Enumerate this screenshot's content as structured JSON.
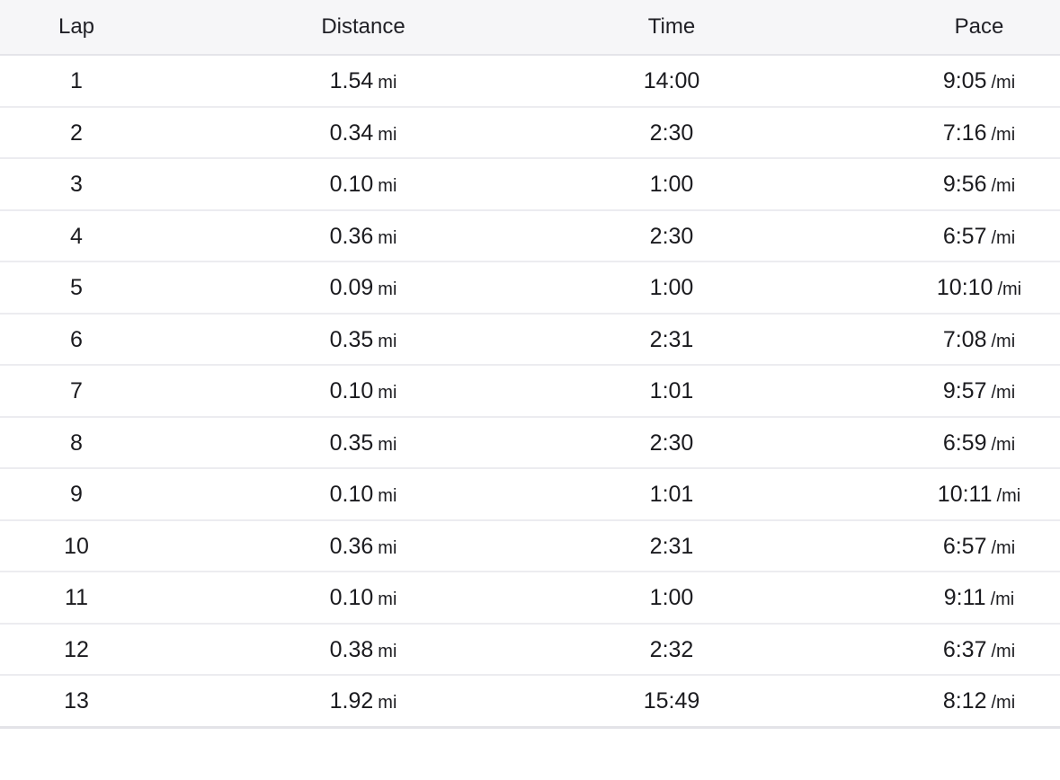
{
  "table": {
    "headers": {
      "lap": "Lap",
      "distance": "Distance",
      "time": "Time",
      "pace": "Pace"
    },
    "distance_unit": "mi",
    "pace_unit": "/mi",
    "rows": [
      {
        "lap": "1",
        "distance": "1.54",
        "time": "14:00",
        "pace": "9:05"
      },
      {
        "lap": "2",
        "distance": "0.34",
        "time": "2:30",
        "pace": "7:16"
      },
      {
        "lap": "3",
        "distance": "0.10",
        "time": "1:00",
        "pace": "9:56"
      },
      {
        "lap": "4",
        "distance": "0.36",
        "time": "2:30",
        "pace": "6:57"
      },
      {
        "lap": "5",
        "distance": "0.09",
        "time": "1:00",
        "pace": "10:10"
      },
      {
        "lap": "6",
        "distance": "0.35",
        "time": "2:31",
        "pace": "7:08"
      },
      {
        "lap": "7",
        "distance": "0.10",
        "time": "1:01",
        "pace": "9:57"
      },
      {
        "lap": "8",
        "distance": "0.35",
        "time": "2:30",
        "pace": "6:59"
      },
      {
        "lap": "9",
        "distance": "0.10",
        "time": "1:01",
        "pace": "10:11"
      },
      {
        "lap": "10",
        "distance": "0.36",
        "time": "2:31",
        "pace": "6:57"
      },
      {
        "lap": "11",
        "distance": "0.10",
        "time": "1:00",
        "pace": "9:11"
      },
      {
        "lap": "12",
        "distance": "0.38",
        "time": "2:32",
        "pace": "6:37"
      },
      {
        "lap": "13",
        "distance": "1.92",
        "time": "15:49",
        "pace": "8:12"
      }
    ]
  },
  "colors": {
    "header_bg": "#f6f6f8",
    "text": "#1b1b1f",
    "divider": "#ececf0"
  }
}
